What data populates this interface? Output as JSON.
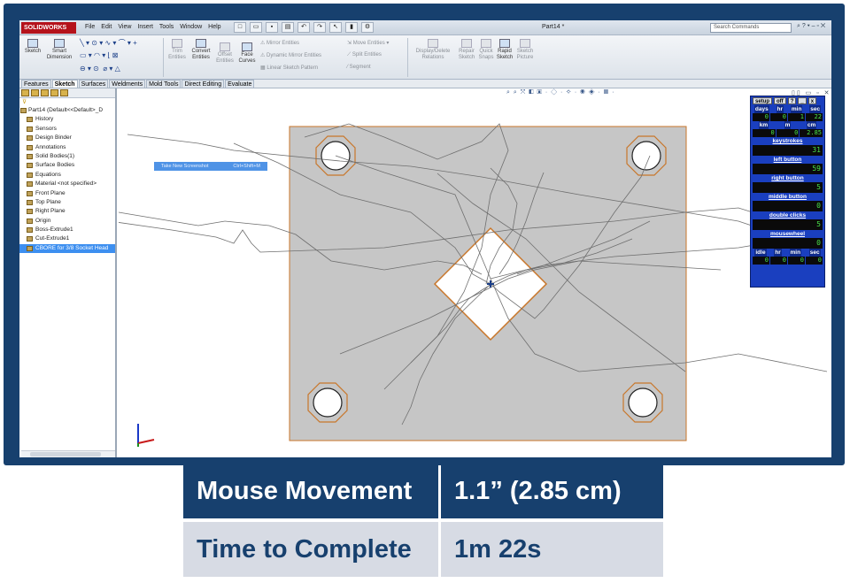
{
  "app": {
    "logo": "SOLIDWORKS",
    "menus": [
      "File",
      "Edit",
      "View",
      "Insert",
      "Tools",
      "Window",
      "Help"
    ],
    "document_title": "Part14 *",
    "search_placeholder": "Search Commands"
  },
  "command_manager": {
    "sketch": "Sketch",
    "smart_dimension": "Smart Dimension",
    "trim_entities": "Trim Entities",
    "convert_entities": "Convert Entities",
    "offset_entities": "Offset Entities",
    "face_curves": "Face Curves",
    "mirror_entities": "Mirror Entities",
    "dynamic_mirror_entities": "Dynamic Mirror Entities",
    "linear_sketch_pattern": "Linear Sketch Pattern",
    "move_entities": "Move Entities",
    "split_entities": "Split Entities",
    "segment": "Segment",
    "display_delete_relations": "Display/Delete Relations",
    "repair_sketch": "Repair Sketch",
    "quick_snaps": "Quick Snaps",
    "rapid_sketch": "Rapid Sketch",
    "sketch_picture": "Sketch Picture"
  },
  "tabs": [
    "Features",
    "Sketch",
    "Surfaces",
    "Weldments",
    "Mold Tools",
    "Direct Editing",
    "Evaluate"
  ],
  "active_tab": "Sketch",
  "feature_tree": [
    {
      "label": "Part14  (Default<<Default>_D",
      "root": true
    },
    {
      "label": "History"
    },
    {
      "label": "Sensors"
    },
    {
      "label": "Design Binder"
    },
    {
      "label": "Annotations"
    },
    {
      "label": "Solid Bodies(1)"
    },
    {
      "label": "Surface Bodies"
    },
    {
      "label": "Equations"
    },
    {
      "label": "Material <not specified>"
    },
    {
      "label": "Front Plane"
    },
    {
      "label": "Top Plane"
    },
    {
      "label": "Right Plane"
    },
    {
      "label": "Origin"
    },
    {
      "label": "Boss-Extrude1"
    },
    {
      "label": "Cut-Extrude1"
    },
    {
      "label": "CBORE for 3/8 Socket Head",
      "selected": true
    }
  ],
  "context_item": {
    "label": "Take New Screenshot",
    "shortcut": "Ctrl+Shift+M"
  },
  "mouse_meter": {
    "buttons": [
      "setup",
      "off",
      "?",
      "_",
      "x"
    ],
    "time_labels": [
      "days",
      "hr",
      "min",
      "sec"
    ],
    "time_values": [
      "0",
      "0",
      "1",
      "22"
    ],
    "dist_labels": [
      "km",
      "m",
      "cm"
    ],
    "dist_values": [
      "0",
      "0",
      "2.85"
    ],
    "keystrokes_title": "keystrokes",
    "keystrokes": "31",
    "left_button_title": "left button",
    "left_button": "59",
    "right_button_title": "right button",
    "right_button": "5",
    "middle_button_title": "middle button",
    "middle_button": "0",
    "double_clicks_title": "double clicks",
    "double_clicks": "5",
    "mousewheel_title": "mousewheel",
    "mousewheel": "0",
    "idle_labels": [
      "idle",
      "hr",
      "min",
      "sec"
    ],
    "idle_values": [
      "0",
      "0",
      "0",
      "0"
    ]
  },
  "stats": {
    "row1_label": "Mouse Movement",
    "row1_value": "1.1” (2.85 cm)",
    "row2_label": "Time to Complete",
    "row2_value": "1m 22s"
  },
  "colors": {
    "frame_navy": "#17406e",
    "stats_gray": "#d7dbe4",
    "plate_gray": "#c6c6c6",
    "edge_orange": "#c8762a",
    "meter_blue": "#1a3fbf",
    "digit_green": "#4ae24a"
  }
}
